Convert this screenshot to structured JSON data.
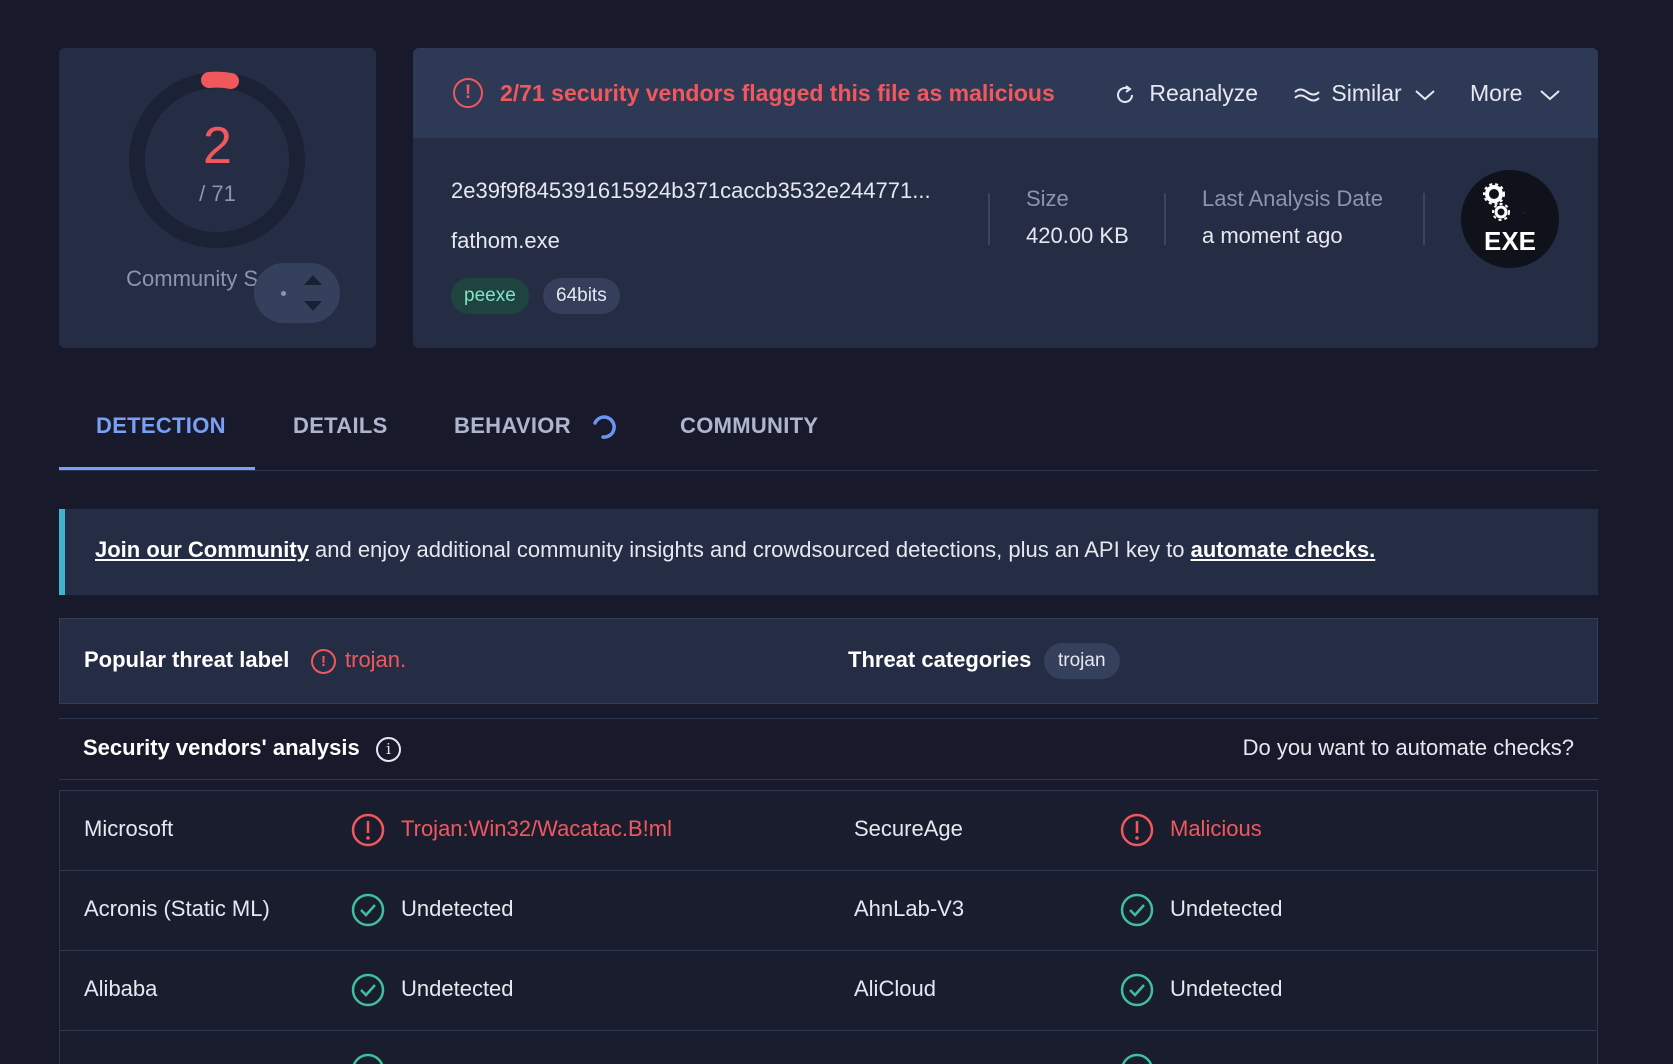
{
  "score": {
    "value": "2",
    "total": "/ 71",
    "community_label": "Community Score"
  },
  "alert": {
    "text": "2/71 security vendors flagged this file as malicious",
    "reanalyze": "Reanalyze",
    "similar": "Similar",
    "more": "More"
  },
  "file": {
    "hash": "2e39f9f845391615924b371caccb3532e244771...",
    "name": "fathom.exe",
    "tags": [
      "peexe",
      "64bits"
    ],
    "size_label": "Size",
    "size_value": "420.00 KB",
    "date_label": "Last Analysis Date",
    "date_value": "a moment ago",
    "type_badge": "EXE"
  },
  "tabs": [
    "DETECTION",
    "DETAILS",
    "BEHAVIOR",
    "COMMUNITY"
  ],
  "banner": {
    "link1": "Join our Community",
    "middle": " and enjoy additional community insights and crowdsourced detections, plus an API key to ",
    "link2": "automate checks."
  },
  "threat": {
    "popular_label": "Popular threat label",
    "popular_value": "trojan.",
    "categories_label": "Threat categories",
    "categories_value": "trojan"
  },
  "vendors_header": {
    "title": "Security vendors' analysis",
    "right": "Do you want to automate checks?"
  },
  "vendors": [
    {
      "left_name": "Microsoft",
      "left_result": "Trojan:Win32/Wacatac.B!ml",
      "left_status": "malicious",
      "right_name": "SecureAge",
      "right_result": "Malicious",
      "right_status": "malicious"
    },
    {
      "left_name": "Acronis (Static ML)",
      "left_result": "Undetected",
      "left_status": "undetected",
      "right_name": "AhnLab-V3",
      "right_result": "Undetected",
      "right_status": "undetected"
    },
    {
      "left_name": "Alibaba",
      "left_result": "Undetected",
      "left_status": "undetected",
      "right_name": "AliCloud",
      "right_result": "Undetected",
      "right_status": "undetected"
    },
    {
      "left_name": "",
      "left_result": "",
      "left_status": "undetected",
      "right_name": "",
      "right_result": "",
      "right_status": "undetected"
    }
  ],
  "colors": {
    "malicious": "#f1585c",
    "accent": "#7aa0f5",
    "ok": "#3fbf9c",
    "banner_border": "#42b3cf"
  }
}
